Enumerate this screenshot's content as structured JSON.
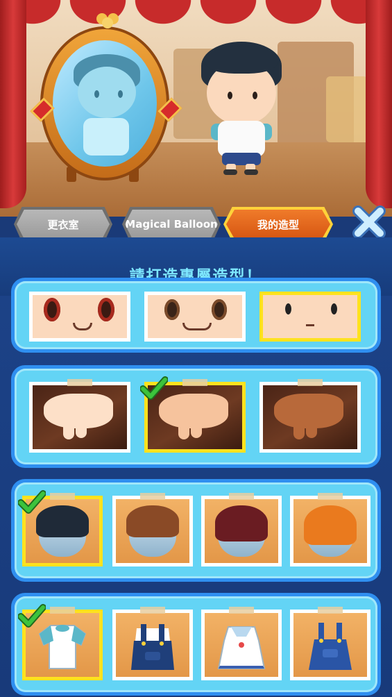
{
  "tabs": [
    {
      "label": "更衣室",
      "active": false
    },
    {
      "label": "Magical Balloon",
      "active": false
    },
    {
      "label": "我的造型",
      "active": true
    }
  ],
  "close_icon": "close-x-icon",
  "banner": {
    "title": "請打造專屬造型！"
  },
  "colors": {
    "accent_orange": "#e0661a",
    "tab_gray": "#a9a9a9",
    "selection_yellow": "#ffe21e",
    "panel_blue": "#2f8ff0",
    "panel_cyan": "#63d4f5",
    "banner_text": "#7ee8ff",
    "check_green": "#3cc33c"
  },
  "sections": [
    {
      "name": "faces",
      "items": [
        {
          "variant": "red-eyes",
          "selected": false
        },
        {
          "variant": "brown-eyes",
          "selected": false
        },
        {
          "variant": "dot-eyes",
          "selected": true
        }
      ]
    },
    {
      "name": "skin",
      "items": [
        {
          "variant": "light-skin",
          "selected": false
        },
        {
          "variant": "medium-skin",
          "selected": true,
          "checked": true
        },
        {
          "variant": "dark-skin",
          "selected": false
        }
      ]
    },
    {
      "name": "hair",
      "items": [
        {
          "variant": "black-short-hair",
          "selected": true,
          "checked": true
        },
        {
          "variant": "brown-hair",
          "selected": false
        },
        {
          "variant": "dark-red-hair",
          "selected": false
        },
        {
          "variant": "orange-hair",
          "selected": false
        }
      ]
    },
    {
      "name": "outfits",
      "items": [
        {
          "variant": "white-tshirt",
          "selected": true,
          "checked": true
        },
        {
          "variant": "navy-overalls",
          "selected": false
        },
        {
          "variant": "white-sailor-dress",
          "selected": false
        },
        {
          "variant": "blue-overall-dress",
          "selected": false
        }
      ]
    }
  ]
}
